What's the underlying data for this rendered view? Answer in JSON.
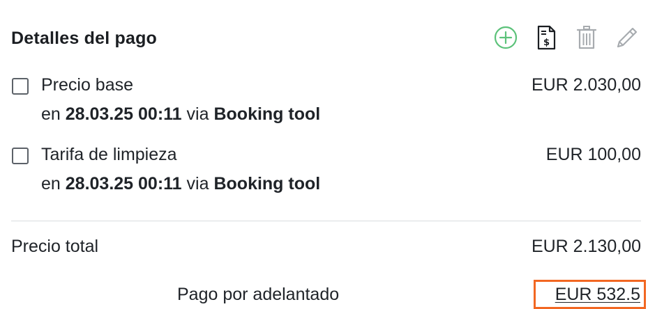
{
  "header": {
    "title": "Detalles del pago",
    "actions": [
      {
        "icon": "plus-circle-icon",
        "color": "#5cc27a"
      },
      {
        "icon": "invoice-dollar-icon",
        "color": "#1b1e22"
      },
      {
        "icon": "trash-icon",
        "color": "#a7abaf"
      },
      {
        "icon": "pencil-icon",
        "color": "#a7abaf"
      }
    ]
  },
  "items": [
    {
      "label": "Precio base",
      "amount": "EUR 2.030,00",
      "prefix": "en",
      "date": "28.03.25 00:11",
      "via": "via",
      "source": "Booking tool"
    },
    {
      "label": "Tarifa de limpieza",
      "amount": "EUR 100,00",
      "prefix": "en",
      "date": "28.03.25 00:11",
      "via": "via",
      "source": "Booking tool"
    }
  ],
  "total": {
    "label": "Precio total",
    "value": "EUR 2.130,00"
  },
  "advance": {
    "label": "Pago por adelantado",
    "value": "EUR 532.5",
    "highlight_color": "#f26722"
  }
}
